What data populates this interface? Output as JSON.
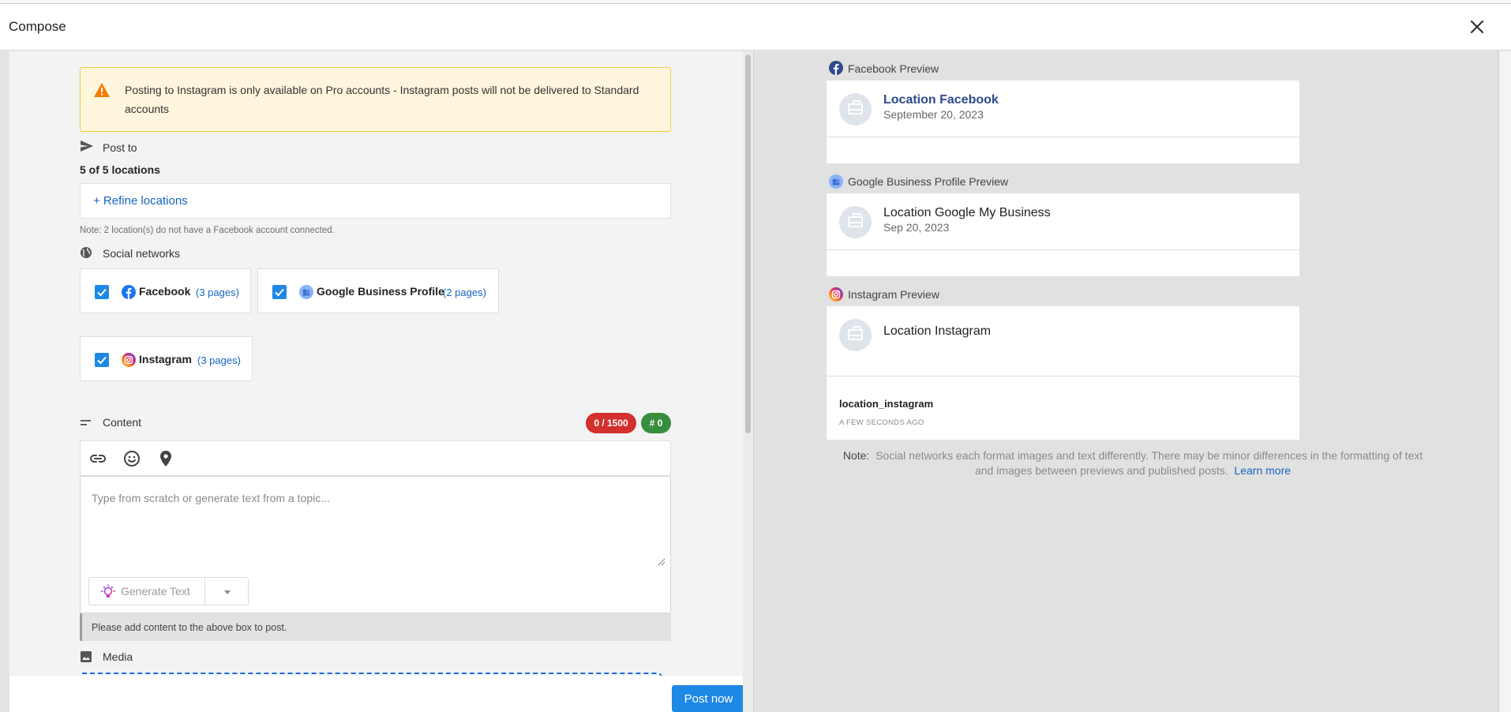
{
  "header": {
    "title": "Compose"
  },
  "warning": {
    "text": "Posting to Instagram is only available on Pro accounts - Instagram posts will not be delivered to Standard accounts"
  },
  "post_to": {
    "label": "Post to",
    "count": "5 of 5 locations",
    "refine_link": "+ Refine locations",
    "note": "Note: 2 location(s) do not have a Facebook account connected."
  },
  "social": {
    "label": "Social networks",
    "networks": [
      {
        "name": "Facebook",
        "pages": "(3 pages)",
        "checked": true,
        "icon": "facebook-icon"
      },
      {
        "name": "Google Business Profile",
        "pages": "(2 pages)",
        "checked": true,
        "icon": "google-business-icon"
      },
      {
        "name": "Instagram",
        "pages": "(3 pages)",
        "checked": true,
        "icon": "instagram-icon"
      }
    ]
  },
  "content": {
    "label": "Content",
    "char_badge": "0 / 1500",
    "hashtag_badge": "# 0",
    "placeholder": "Type from scratch or generate text from a topic...",
    "generate_label": "Generate Text",
    "hint": "Please add content to the above box to post."
  },
  "media": {
    "label": "Media"
  },
  "footer": {
    "post_now": "Post now"
  },
  "previews": {
    "facebook": {
      "label": "Facebook Preview",
      "name": "Location Facebook",
      "date": "September 20, 2023"
    },
    "google": {
      "label": "Google Business Profile Preview",
      "name": "Location Google My Business",
      "date": "Sep 20, 2023"
    },
    "instagram": {
      "label": "Instagram Preview",
      "name": "Location Instagram",
      "username": "location_instagram",
      "time": "A FEW SECONDS AGO"
    },
    "note_label": "Note:",
    "note_text": "Social networks each format images and text differently. There may be minor differences in the formatting of text and images between previews and published posts.",
    "learn_more": "Learn more"
  },
  "colors": {
    "accent": "#1e88e5",
    "link": "#1565c0",
    "char_badge": "#d32f2f",
    "hashtag_badge": "#388e3c",
    "facebook_name": "#2d4a8a",
    "warning_bg": "#fdf6dd"
  }
}
